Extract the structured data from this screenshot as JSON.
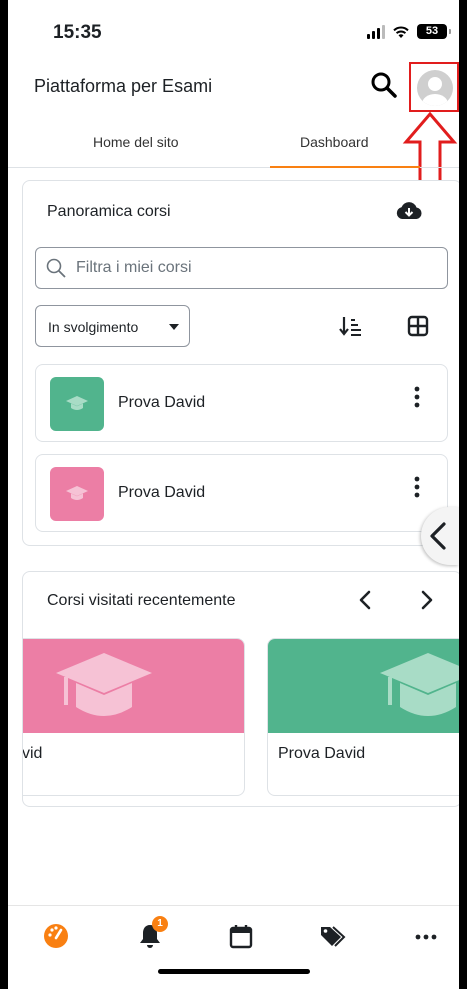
{
  "status_bar": {
    "time": "15:35",
    "battery": "53"
  },
  "header": {
    "title": "Piattaforma per Esami"
  },
  "tabs": [
    {
      "label": "Home del sito",
      "active": false
    },
    {
      "label": "Dashboard",
      "active": true
    }
  ],
  "overview": {
    "title": "Panoramica corsi",
    "filter_placeholder": "Filtra i miei corsi",
    "grouping_selected": "In svolgimento",
    "courses": [
      {
        "name": "Prova David",
        "color": "#51b48d"
      },
      {
        "name": "Prova David",
        "color": "#ec7ea5"
      }
    ]
  },
  "recent": {
    "title": "Corsi visitati recentemente",
    "cards": [
      {
        "name": "Prova David",
        "visible_text": "vid",
        "color": "#ec7ea5"
      },
      {
        "name": "Prova David",
        "visible_text": "Prova David",
        "color": "#51b48d"
      }
    ]
  },
  "bottom_nav": {
    "items": [
      "dashboard-icon",
      "notifications-icon",
      "calendar-icon",
      "tags-icon",
      "more-icon"
    ],
    "notification_count": "1"
  },
  "colors": {
    "accent": "#f98012",
    "highlight": "#e11d1d"
  }
}
